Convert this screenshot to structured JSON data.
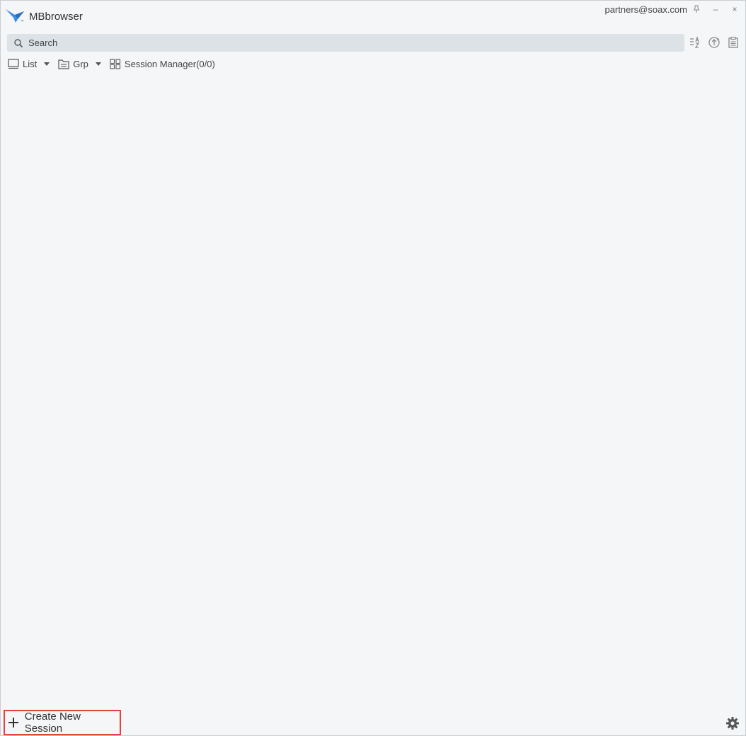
{
  "app": {
    "title": "MBbrowser",
    "logo_icon": "bird-logo-icon",
    "accent_color": "#3a8ee6"
  },
  "window": {
    "account": "partners@soax.com",
    "pin_icon": "pin-icon",
    "minimize_label": "–",
    "close_label": "×"
  },
  "search": {
    "placeholder": "Search",
    "value": ""
  },
  "toolbar": {
    "sort_icon": "sort-az-icon",
    "sync_icon": "sync-icon",
    "clipboard_icon": "clipboard-icon"
  },
  "view": {
    "list_label": "List",
    "group_label": "Grp",
    "session_manager_label": "Session Manager(0/0)"
  },
  "footer": {
    "create_label": "Create New Session",
    "highlight_color": "#e0443c",
    "settings_icon": "gear-icon"
  }
}
